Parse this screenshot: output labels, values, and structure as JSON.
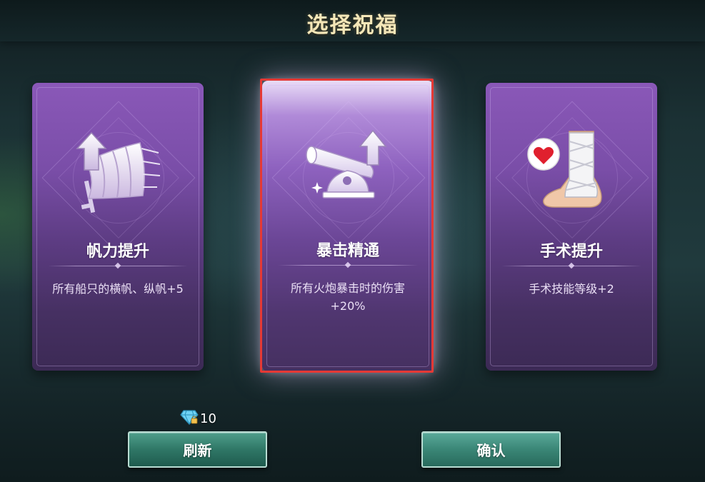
{
  "header": {
    "title": "选择祝福"
  },
  "cards": [
    {
      "title": "帆力提升",
      "desc": "所有船只的横帆、纵帆+5",
      "icon": "sail-upgrade-icon"
    },
    {
      "title": "暴击精通",
      "desc": "所有火炮暴击时的伤害+20%",
      "icon": "cannon-upgrade-icon",
      "selected": true
    },
    {
      "title": "手术提升",
      "desc": "手术技能等级+2",
      "icon": "bandaged-foot-heart-icon"
    }
  ],
  "refresh": {
    "cost": "10",
    "cost_icon": "diamond-icon",
    "label": "刷新"
  },
  "confirm": {
    "label": "确认"
  },
  "colors": {
    "card_purple": "#7a4ea8",
    "button_teal": "#2f7766",
    "selection_red": "#e53935",
    "title_gold": "#f5e7b8"
  }
}
